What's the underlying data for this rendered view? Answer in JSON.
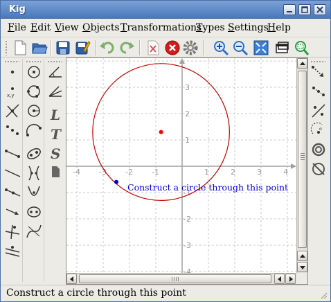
{
  "window": {
    "title": "Kig"
  },
  "menu": [
    {
      "label": "File"
    },
    {
      "label": "Edit"
    },
    {
      "label": "View"
    },
    {
      "label": "Objects"
    },
    {
      "label": "Transformations"
    },
    {
      "label": "Types"
    },
    {
      "label": "Settings"
    },
    {
      "label": "Help"
    }
  ],
  "toolbar_icons": [
    "new-document-icon",
    "open-folder-icon",
    "save-icon",
    "save-as-icon",
    "undo-icon",
    "redo-icon",
    "delete-icon",
    "cancel-construction-icon",
    "settings-gear-icon",
    "zoom-in-icon",
    "zoom-out-icon",
    "fit-to-screen-icon",
    "full-screen-icon",
    "zoom-area-icon"
  ],
  "canvas": {
    "x_ticks": [
      "-4",
      "-3",
      "-2",
      "-1",
      "1",
      "2",
      "3",
      "4"
    ],
    "y_ticks": [
      "3",
      "2",
      "1",
      "-1",
      "-2",
      "-3",
      "-4"
    ],
    "tooltip": "Construct a circle through this point",
    "circle_color": "#cc0000",
    "center_point_color": "#ff0000",
    "cursor_point_color": "#0000cc",
    "tooltip_color": "#0000cc",
    "grid_color": "#c8c8c8",
    "axis_color": "#a0a0a0"
  },
  "geometry": {
    "circle_center": [
      -0.8,
      1.3
    ],
    "circle_radius": 2.6,
    "cursor_point": [
      -2.5,
      -0.6
    ]
  },
  "status": {
    "text": "Construct a circle through this point"
  },
  "colors": {
    "titlebar": "#4a78bb",
    "background": "#ecebe6"
  }
}
